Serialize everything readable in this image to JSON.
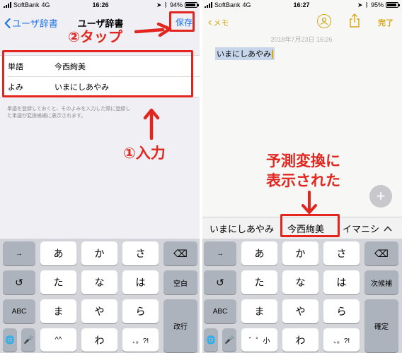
{
  "left": {
    "status": {
      "carrier": "SoftBank",
      "network": "4G",
      "time": "16:26",
      "battery": "94%",
      "battery_level": 0.94
    },
    "nav": {
      "back_label": "ユーザ辞書",
      "title": "ユーザ辞書",
      "save_label": "保存"
    },
    "form": [
      {
        "label": "単語",
        "value": "今西絢美"
      },
      {
        "label": "よみ",
        "value": "いまにしあやみ"
      }
    ],
    "help_text": "単語を登録しておくと、そのよみを入力した際に登録した単語が変換候補に表示されます。",
    "annotation_tap": "②タップ",
    "annotation_input": "①入力",
    "keyboard": {
      "row1": [
        "→",
        "あ",
        "か",
        "さ",
        "⌫"
      ],
      "row2": [
        "↺",
        "た",
        "な",
        "は",
        "空白"
      ],
      "row3": [
        "ABC",
        "ま",
        "や",
        "ら"
      ],
      "row4": [
        "🌐",
        "🎤",
        "^^",
        "わ",
        "、。?!"
      ],
      "return": "改行"
    }
  },
  "right": {
    "status": {
      "carrier": "SoftBank",
      "network": "4G",
      "time": "16:27",
      "battery": "95%",
      "battery_level": 0.95
    },
    "nav": {
      "back_label": "メモ",
      "done_label": "完了"
    },
    "note": {
      "date": "2018年7月23日 16:26",
      "text": "いまにしあやみ"
    },
    "annotation_line1": "予測変換に",
    "annotation_line2": "表示された",
    "predictions": [
      "いまにしあやみ",
      "今西絢美",
      "イマニシ"
    ],
    "keyboard": {
      "row1": [
        "→",
        "あ",
        "か",
        "さ",
        "⌫"
      ],
      "row2": [
        "↺",
        "た",
        "な",
        "は",
        "次候補"
      ],
      "row3": [
        "ABC",
        "ま",
        "や",
        "ら"
      ],
      "row4": [
        "🌐",
        "🎤",
        "゛゜小",
        "わ",
        "、。?!"
      ],
      "return": "確定"
    }
  },
  "colors": {
    "accent_blue": "#1c74e8",
    "accent_gold": "#d4a61b",
    "annotation_red": "#e2261f"
  }
}
